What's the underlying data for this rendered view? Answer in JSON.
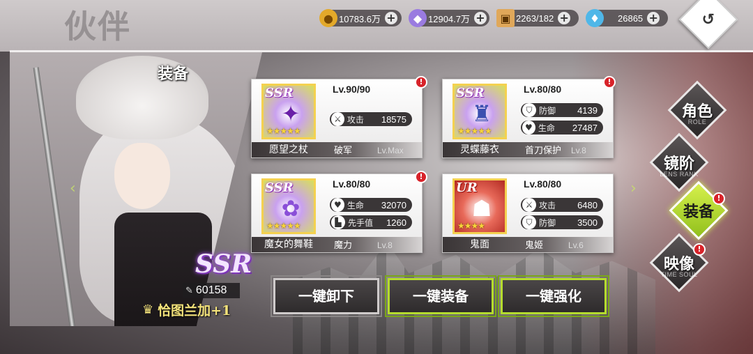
{
  "header": {
    "title": "伙伴"
  },
  "currencies": [
    {
      "icon": "gold-coin-icon",
      "value": "10783.6万"
    },
    {
      "icon": "purple-crystal-icon",
      "value": "12904.7万"
    },
    {
      "icon": "supply-box-icon",
      "value": "2263/182"
    },
    {
      "icon": "diamond-icon",
      "value": "26865"
    }
  ],
  "character": {
    "section_title": "装备",
    "rarity": "SSR",
    "power": "60158",
    "bond_text": "恰图兰加+1"
  },
  "equipment": [
    {
      "rarity": "SSR",
      "level": "Lv.90/90",
      "name": "愿望之杖",
      "set_name": "破军",
      "set_level": "Lv.Max",
      "stats": [
        {
          "icon": "sword-cross-icon",
          "label": "攻击",
          "value": "18575"
        }
      ],
      "stars": 5,
      "alert": "!"
    },
    {
      "rarity": "SSR",
      "level": "Lv.80/80",
      "name": "灵蝶藤衣",
      "set_name": "首刀保护",
      "set_level": "Lv.8",
      "stats": [
        {
          "icon": "shield-icon",
          "label": "防御",
          "value": "4139"
        },
        {
          "icon": "heart-icon",
          "label": "生命",
          "value": "27487"
        }
      ],
      "stars": 5,
      "alert": "!"
    },
    {
      "rarity": "SSR",
      "level": "Lv.80/80",
      "name": "魔女的舞鞋",
      "set_name": "魔力",
      "set_level": "Lv.8",
      "stats": [
        {
          "icon": "heart-icon",
          "label": "生命",
          "value": "32070"
        },
        {
          "icon": "boot-icon",
          "label": "先手值",
          "value": "1260"
        }
      ],
      "stars": 5,
      "alert": "!"
    },
    {
      "rarity": "UR",
      "level": "Lv.80/80",
      "name": "鬼面",
      "set_name": "鬼姬",
      "set_level": "Lv.6",
      "stats": [
        {
          "icon": "sword-cross-icon",
          "label": "攻击",
          "value": "6480"
        },
        {
          "icon": "shield-icon",
          "label": "防御",
          "value": "3500"
        }
      ],
      "stars": 4,
      "alert": "!"
    }
  ],
  "actions": {
    "unequip_all": "一键卸下",
    "equip_all": "一键装备",
    "enhance_all": "一键强化"
  },
  "tabs": [
    {
      "label": "角色",
      "sub": "ROLE",
      "active": false,
      "alert": ""
    },
    {
      "label": "镜阶",
      "sub": "LENS RANK",
      "active": false,
      "alert": ""
    },
    {
      "label": "装备",
      "sub": "",
      "active": true,
      "alert": "!"
    },
    {
      "label": "映像",
      "sub": "TIME SOUL",
      "active": false,
      "alert": "!"
    }
  ],
  "colors": {
    "accent_green": "#b5dc2e",
    "alert_red": "#d8232a",
    "rarity_gold": "#f4d150"
  }
}
